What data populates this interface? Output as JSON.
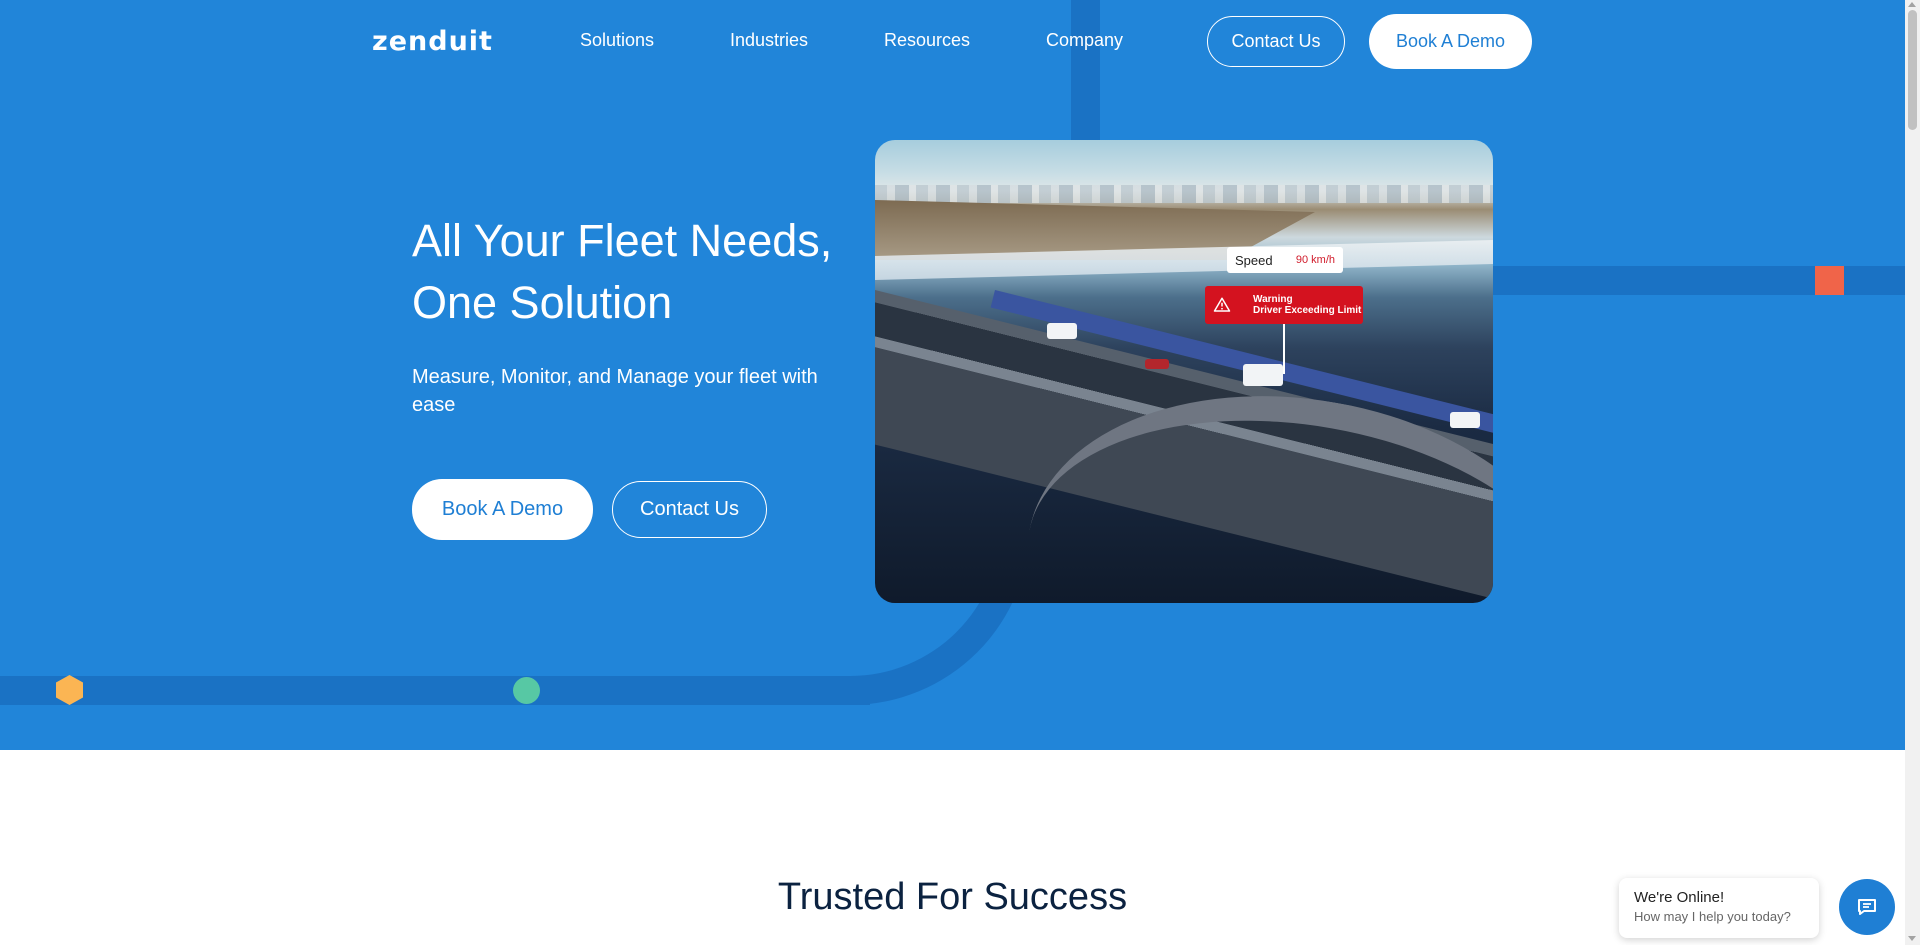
{
  "header": {
    "logo_text": "zenduit",
    "nav": [
      {
        "label": "Solutions"
      },
      {
        "label": "Industries"
      },
      {
        "label": "Resources"
      },
      {
        "label": "Company"
      }
    ],
    "contact_label": "Contact Us",
    "demo_label": "Book A Demo"
  },
  "hero": {
    "title_line1": "All Your Fleet Needs,",
    "title_line2": "One Solution",
    "subtitle": "Measure, Monitor, and Manage your fleet with ease",
    "demo_label": "Book A Demo",
    "contact_label": "Contact Us"
  },
  "media": {
    "speed_label": "Speed",
    "speed_value": "90 km/h",
    "warning_title": "Warning",
    "warning_message": "Driver Exceeding Limit"
  },
  "section": {
    "title": "Trusted For Success"
  },
  "chat": {
    "title": "We're Online!",
    "subtitle": "How may I help you today?"
  },
  "colors": {
    "hero_bg": "#2185d9",
    "accent_dark": "#1a72c4",
    "button_text": "#1f7fd4",
    "orange_square": "#f06449",
    "hexagon": "#fbb553",
    "green_dot": "#57c8a4",
    "warning_red": "#d4121f",
    "heading_dark": "#0b2240"
  },
  "icons": {
    "warning": "warning-triangle-icon",
    "chat": "chat-icon"
  }
}
